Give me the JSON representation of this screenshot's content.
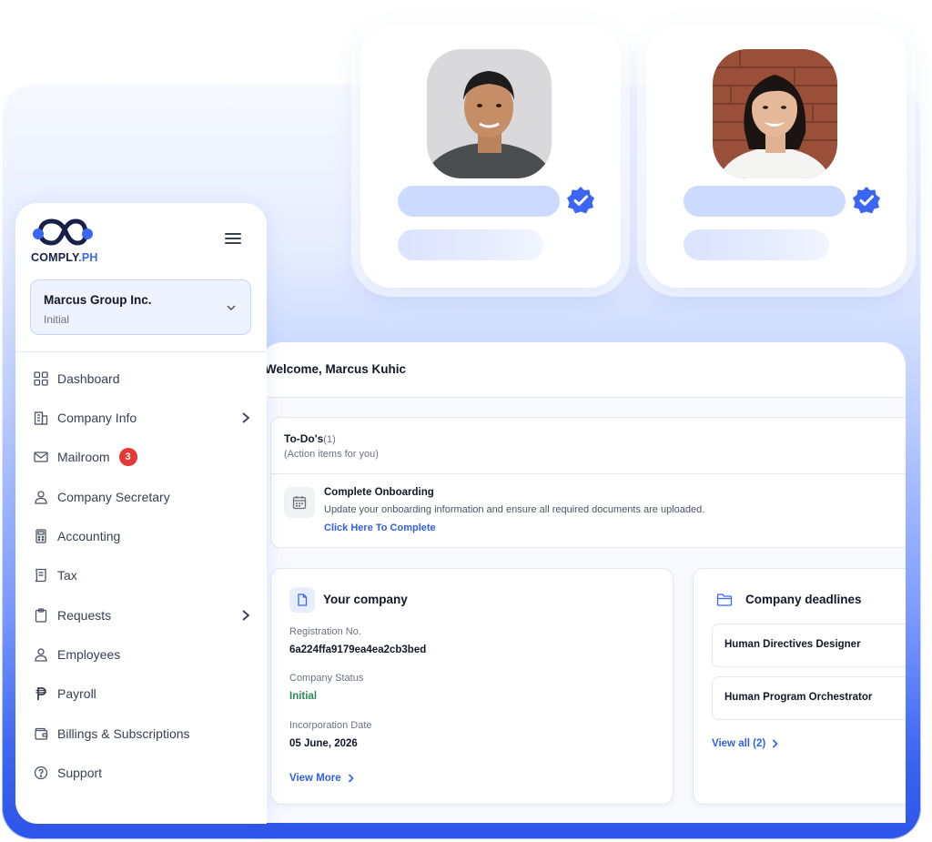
{
  "brand": {
    "logo_text": "COMPLY",
    "logo_suffix": ".PH",
    "accent": "#3b66f5",
    "dark": "#16204a"
  },
  "profiles": [
    {
      "avatar": "man-photo",
      "verified": true
    },
    {
      "avatar": "woman-photo",
      "verified": true
    }
  ],
  "sidebar": {
    "company": {
      "name": "Marcus Group Inc.",
      "status": "Initial"
    },
    "items": [
      {
        "label": "Dashboard",
        "icon": "grid-icon"
      },
      {
        "label": "Company Info",
        "icon": "building-icon",
        "has_submenu": true
      },
      {
        "label": "Mailroom",
        "icon": "mail-icon",
        "badge": "3"
      },
      {
        "label": "Company Secretary",
        "icon": "person-icon"
      },
      {
        "label": "Accounting",
        "icon": "calculator-icon"
      },
      {
        "label": "Tax",
        "icon": "receipt-icon"
      },
      {
        "label": "Requests",
        "icon": "clipboard-icon",
        "has_submenu": true
      },
      {
        "label": "Employees",
        "icon": "person-icon"
      },
      {
        "label": "Payroll",
        "icon": "peso-icon"
      },
      {
        "label": "Billings & Subscriptions",
        "icon": "wallet-icon"
      },
      {
        "label": "Support",
        "icon": "help-icon"
      }
    ]
  },
  "main": {
    "welcome": "Welcome, Marcus Kuhic",
    "todos": {
      "title": "To-Do's",
      "count": "(1)",
      "subtitle": "(Action items for you)",
      "item": {
        "title": "Complete Onboarding",
        "description": "Update your onboarding information and ensure all required documents are uploaded.",
        "link": "Click Here To Complete"
      }
    },
    "company_card": {
      "title": "Your company",
      "registration_label": "Registration No.",
      "registration_value": "6a224ffa9179ea4ea2cb3bed",
      "status_label": "Company Status",
      "status_value": "Initial",
      "incorporation_label": "Incorporation Date",
      "incorporation_value": "05 June, 2026",
      "view_more": "View More"
    },
    "deadlines_card": {
      "title": "Company deadlines",
      "items": [
        "Human Directives Designer",
        "Human Program Orchestrator"
      ],
      "view_all": "View all (2)"
    }
  },
  "colors": {
    "status_green": "#2e8b57",
    "link_blue": "#2f5fe8",
    "badge_red": "#e53935"
  }
}
